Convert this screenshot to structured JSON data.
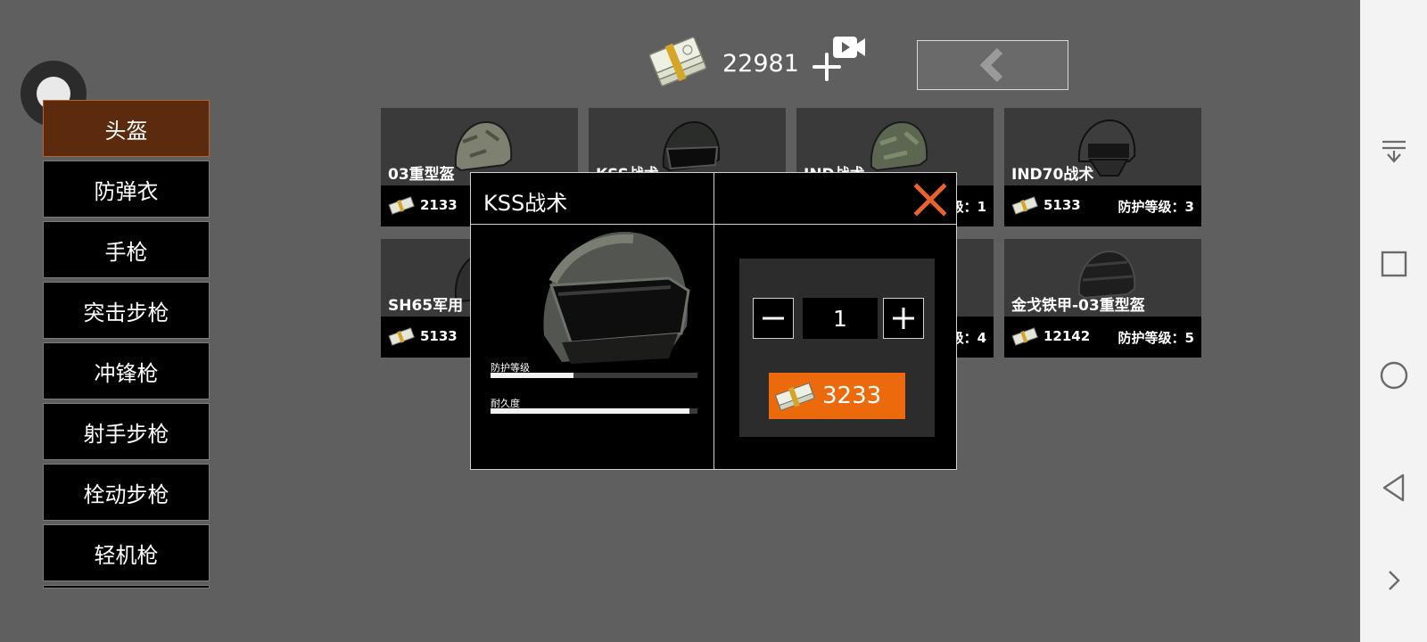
{
  "top": {
    "money": "22981",
    "money_icon": "cash-stack-icon",
    "add_icon": "plus-icon",
    "video_icon": "video-camera-icon",
    "back_icon": "chevron-left-icon"
  },
  "categories": [
    {
      "label": "头盔",
      "active": true
    },
    {
      "label": "防弹衣",
      "active": false
    },
    {
      "label": "手枪",
      "active": false
    },
    {
      "label": "突击步枪",
      "active": false
    },
    {
      "label": "冲锋枪",
      "active": false
    },
    {
      "label": "射手步枪",
      "active": false
    },
    {
      "label": "栓动步枪",
      "active": false
    },
    {
      "label": "轻机枪",
      "active": false
    }
  ],
  "items": [
    {
      "name": "03重型盔",
      "price": "2133",
      "level": ""
    },
    {
      "name": "KSS战术",
      "price": "",
      "level": ""
    },
    {
      "name": "IND战术",
      "price": "",
      "level": "级：1"
    },
    {
      "name": "IND70战术",
      "price": "5133",
      "level": "防护等级：3"
    },
    {
      "name": "SH65军用",
      "price": "5133",
      "level": ""
    },
    {
      "name": "",
      "price": "",
      "level": ""
    },
    {
      "name": "",
      "price": "",
      "level": "级：4"
    },
    {
      "name": "金戈铁甲-03重型盔",
      "price": "12142",
      "level": "防护等级：5"
    }
  ],
  "modal": {
    "title": "KSS战术",
    "close_icon": "close-x-icon",
    "stats": [
      {
        "label": "防护等级",
        "value": 0.4
      },
      {
        "label": "耐久度",
        "value": 0.96
      }
    ],
    "quantity": "1",
    "minus_icon": "minus-icon",
    "plus_icon": "plus-icon",
    "buy_price": "3233"
  },
  "colors": {
    "accent": "#ec6a0c",
    "active_category": "#5c2a0c",
    "close": "#e8622c",
    "background": "#5f5f5f"
  }
}
